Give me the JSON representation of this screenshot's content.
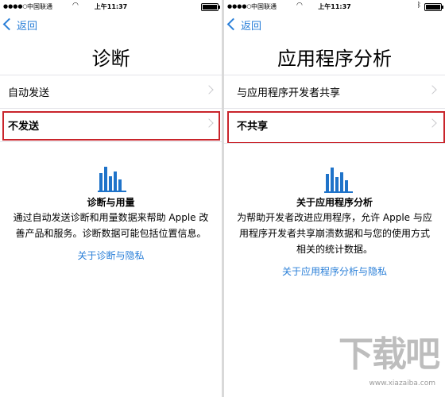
{
  "left": {
    "status": {
      "carrier": "中国联通",
      "time": "上午11:37"
    },
    "nav": {
      "back_label": "返回"
    },
    "title": "诊断",
    "rows": [
      {
        "label": "自动发送"
      },
      {
        "label": "不发送",
        "highlighted": true
      }
    ],
    "info": {
      "icon": "bar-chart-icon",
      "heading": "诊断与用量",
      "text_line1": "通过自动发送诊断和用量数据来帮助 Apple 改",
      "text_line2": "善产品和服务。诊断数据可能包括位置信息。",
      "link": "关于诊断与隐私"
    }
  },
  "right": {
    "status": {
      "carrier": "中国联通",
      "time": "上午11:37"
    },
    "nav": {
      "back_label": "返回"
    },
    "title": "应用程序分析",
    "rows": [
      {
        "label": "与应用程序开发者共享"
      },
      {
        "label": "不共享",
        "highlighted": true
      }
    ],
    "info": {
      "icon": "bar-chart-icon",
      "heading": "关于应用程序分析",
      "text_line1": "为帮助开发者改进应用程序，允许 Apple 与应",
      "text_line2": "用程序开发者共享崩溃数据和与您的使用方式",
      "text_line3": "相关的统计数据。",
      "link": "关于应用程序分析与隐私"
    }
  },
  "watermark": {
    "brand": "下载吧",
    "url": "www.xiazaiba.com"
  },
  "colors": {
    "accent": "#2a7fd8",
    "highlight": "#c9242b",
    "icon": "#1f73c9"
  }
}
